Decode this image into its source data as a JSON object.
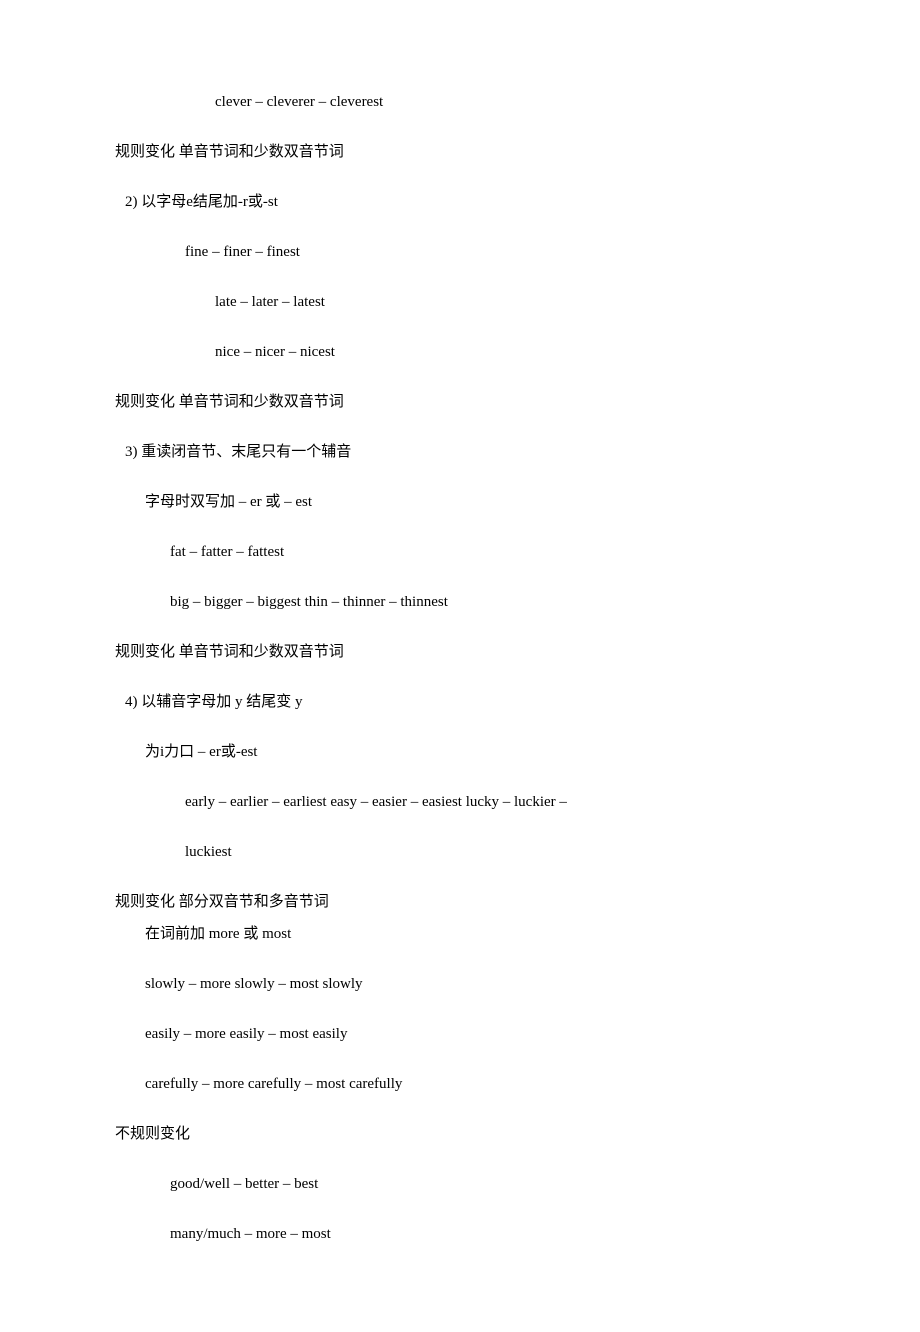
{
  "lines": [
    {
      "text": "clever – cleverer – cleverest",
      "indent": "indent-6"
    },
    {
      "text": "规则变化 单音节词和少数双音节词",
      "indent": "indent-1"
    },
    {
      "text": "2) 以字母e结尾加-r或-st",
      "indent": "indent-2"
    },
    {
      "text": "fine – finer – finest",
      "indent": "indent-ex"
    },
    {
      "text": "late – later – latest",
      "indent": "indent-6"
    },
    {
      "text": "nice – nicer – nicest",
      "indent": "indent-6"
    },
    {
      "text": "规则变化 单音节词和少数双音节词",
      "indent": "indent-1"
    },
    {
      "text": "3) 重读闭音节、末尾只有一个辅音",
      "indent": "indent-2"
    },
    {
      "text": "字母时双写加 – er 或 – est",
      "indent": "indent-3"
    },
    {
      "text": "fat – fatter – fattest",
      "indent": "indent-4"
    },
    {
      "text": "big – bigger – biggest thin – thinner – thinnest",
      "indent": "indent-4"
    },
    {
      "text": "规则变化 单音节词和少数双音节词",
      "indent": "indent-1"
    },
    {
      "text": "4) 以辅音字母加 y 结尾变 y",
      "indent": "indent-2"
    },
    {
      "text": "为i力口 – er或-est",
      "indent": "indent-3"
    },
    {
      "text": "early – earlier – earliest easy – easier – easiest lucky – luckier –",
      "indent": "indent-5"
    },
    {
      "text": "luckiest",
      "indent": "indent-5"
    },
    {
      "text": "规则变化 部分双音节和多音节词",
      "indent": "indent-1",
      "tight": true
    },
    {
      "text": "在词前加 more 或 most",
      "indent": "indent-3"
    },
    {
      "text": "slowly – more slowly – most slowly",
      "indent": "indent-3"
    },
    {
      "text": "easily – more easily – most easily",
      "indent": "indent-3"
    },
    {
      "text": "carefully – more carefully – most carefully",
      "indent": "indent-3"
    },
    {
      "text": "不规则变化",
      "indent": "indent-1"
    },
    {
      "text": "good/well – better – best",
      "indent": "indent-4"
    },
    {
      "text": "many/much – more – most",
      "indent": "indent-4"
    }
  ]
}
